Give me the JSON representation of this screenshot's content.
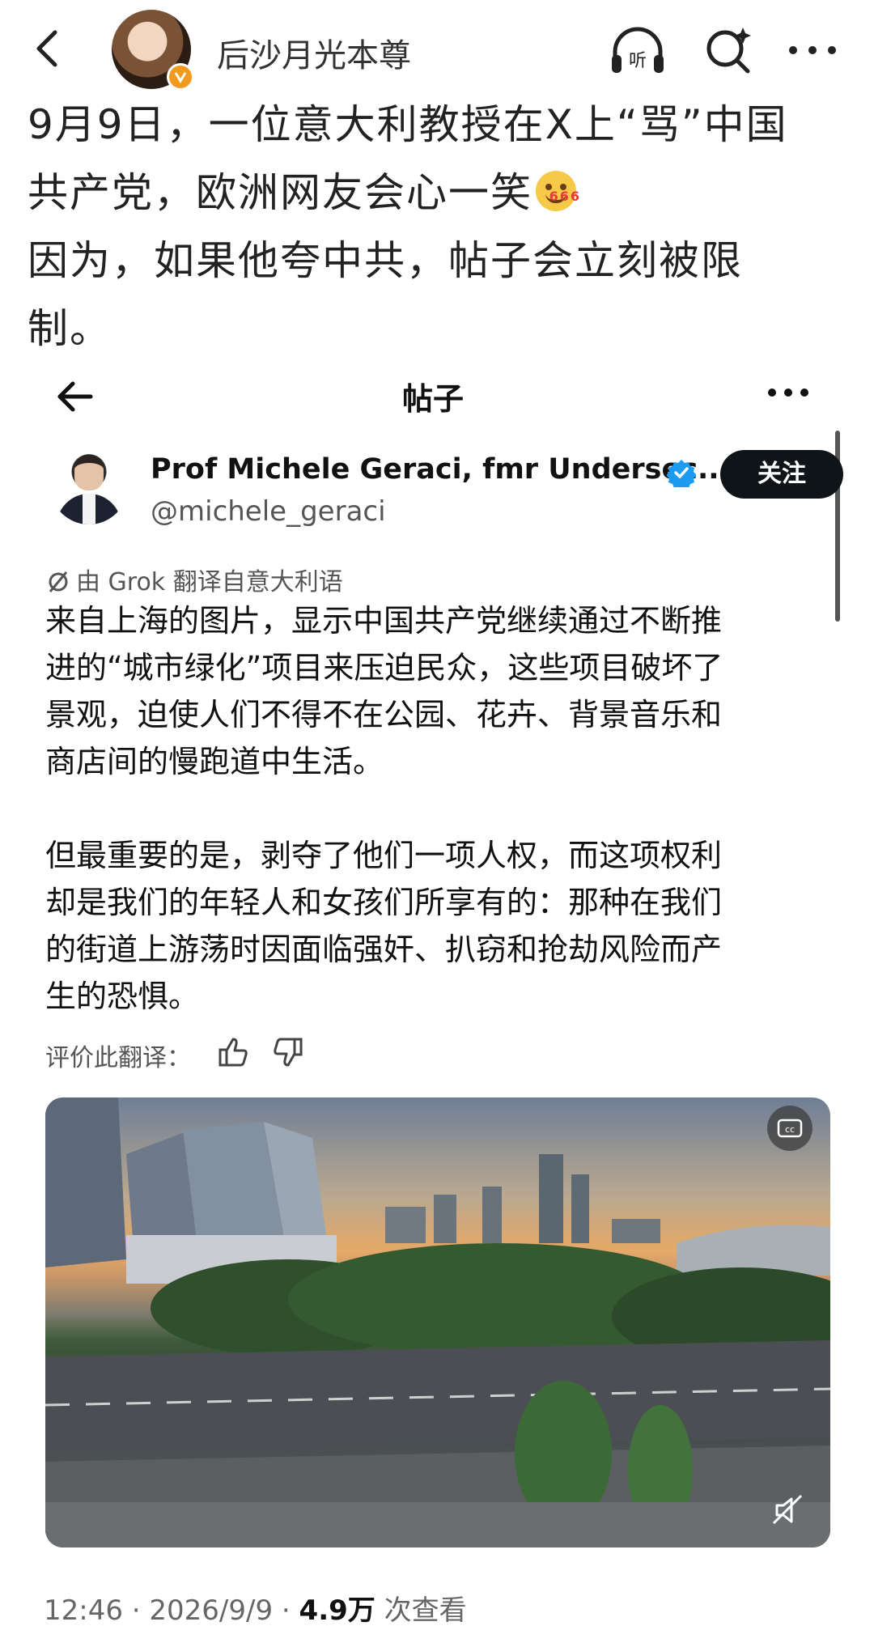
{
  "app_bar": {
    "username": "后沙月光本尊",
    "icons": [
      "back-arrow-icon",
      "verified-v-badge-icon",
      "listen-headphones-icon",
      "ai-search-icon",
      "more-dots-icon"
    ]
  },
  "post": {
    "lines": [
      "9月9日，一位意大利教授在X上“骂”中国",
      "共产党，欧洲网友会心一笑",
      "因为，如果他夸中共，帖子会立刻被限",
      "制。"
    ],
    "emoji_badge": "666"
  },
  "embedded_tweet": {
    "header_title": "帖子",
    "author_name": "Prof Michele Geraci, fmr Undersec...",
    "handle": "@michele_geraci",
    "follow_label": "关注",
    "translation_note": "由 Grok 翻译自意大利语",
    "body_paragraph_1": [
      "来自上海的图片，显示中国共产党继续通过不断推",
      "进的“城市绿化”项目来压迫民众，这些项目破坏了",
      "景观，迫使人们不得不在公园、花卉、背景音乐和",
      "商店间的慢跑道中生活。"
    ],
    "body_paragraph_2": [
      "但最重要的是，剥夺了他们一项人权，而这项权利",
      "却是我们的年轻人和女孩们所享有的：那种在我们",
      "的街道上游荡时因面临强奸、扒窃和抢劫风险而产",
      "生的恐惧。"
    ],
    "rate_label": "评价此翻译：",
    "media_alt_icons": [
      "cc-captions-icon",
      "muted-speaker-icon"
    ],
    "meta": {
      "time_date": "12:46 · 2026/9/9 · ",
      "views_count": "4.9万",
      "views_label": " 次查看"
    }
  },
  "colors": {
    "follow_button_bg": "#0f1419",
    "verified_blue": "#1d9bf0",
    "weibo_badge_orange": "#f39a1e"
  }
}
